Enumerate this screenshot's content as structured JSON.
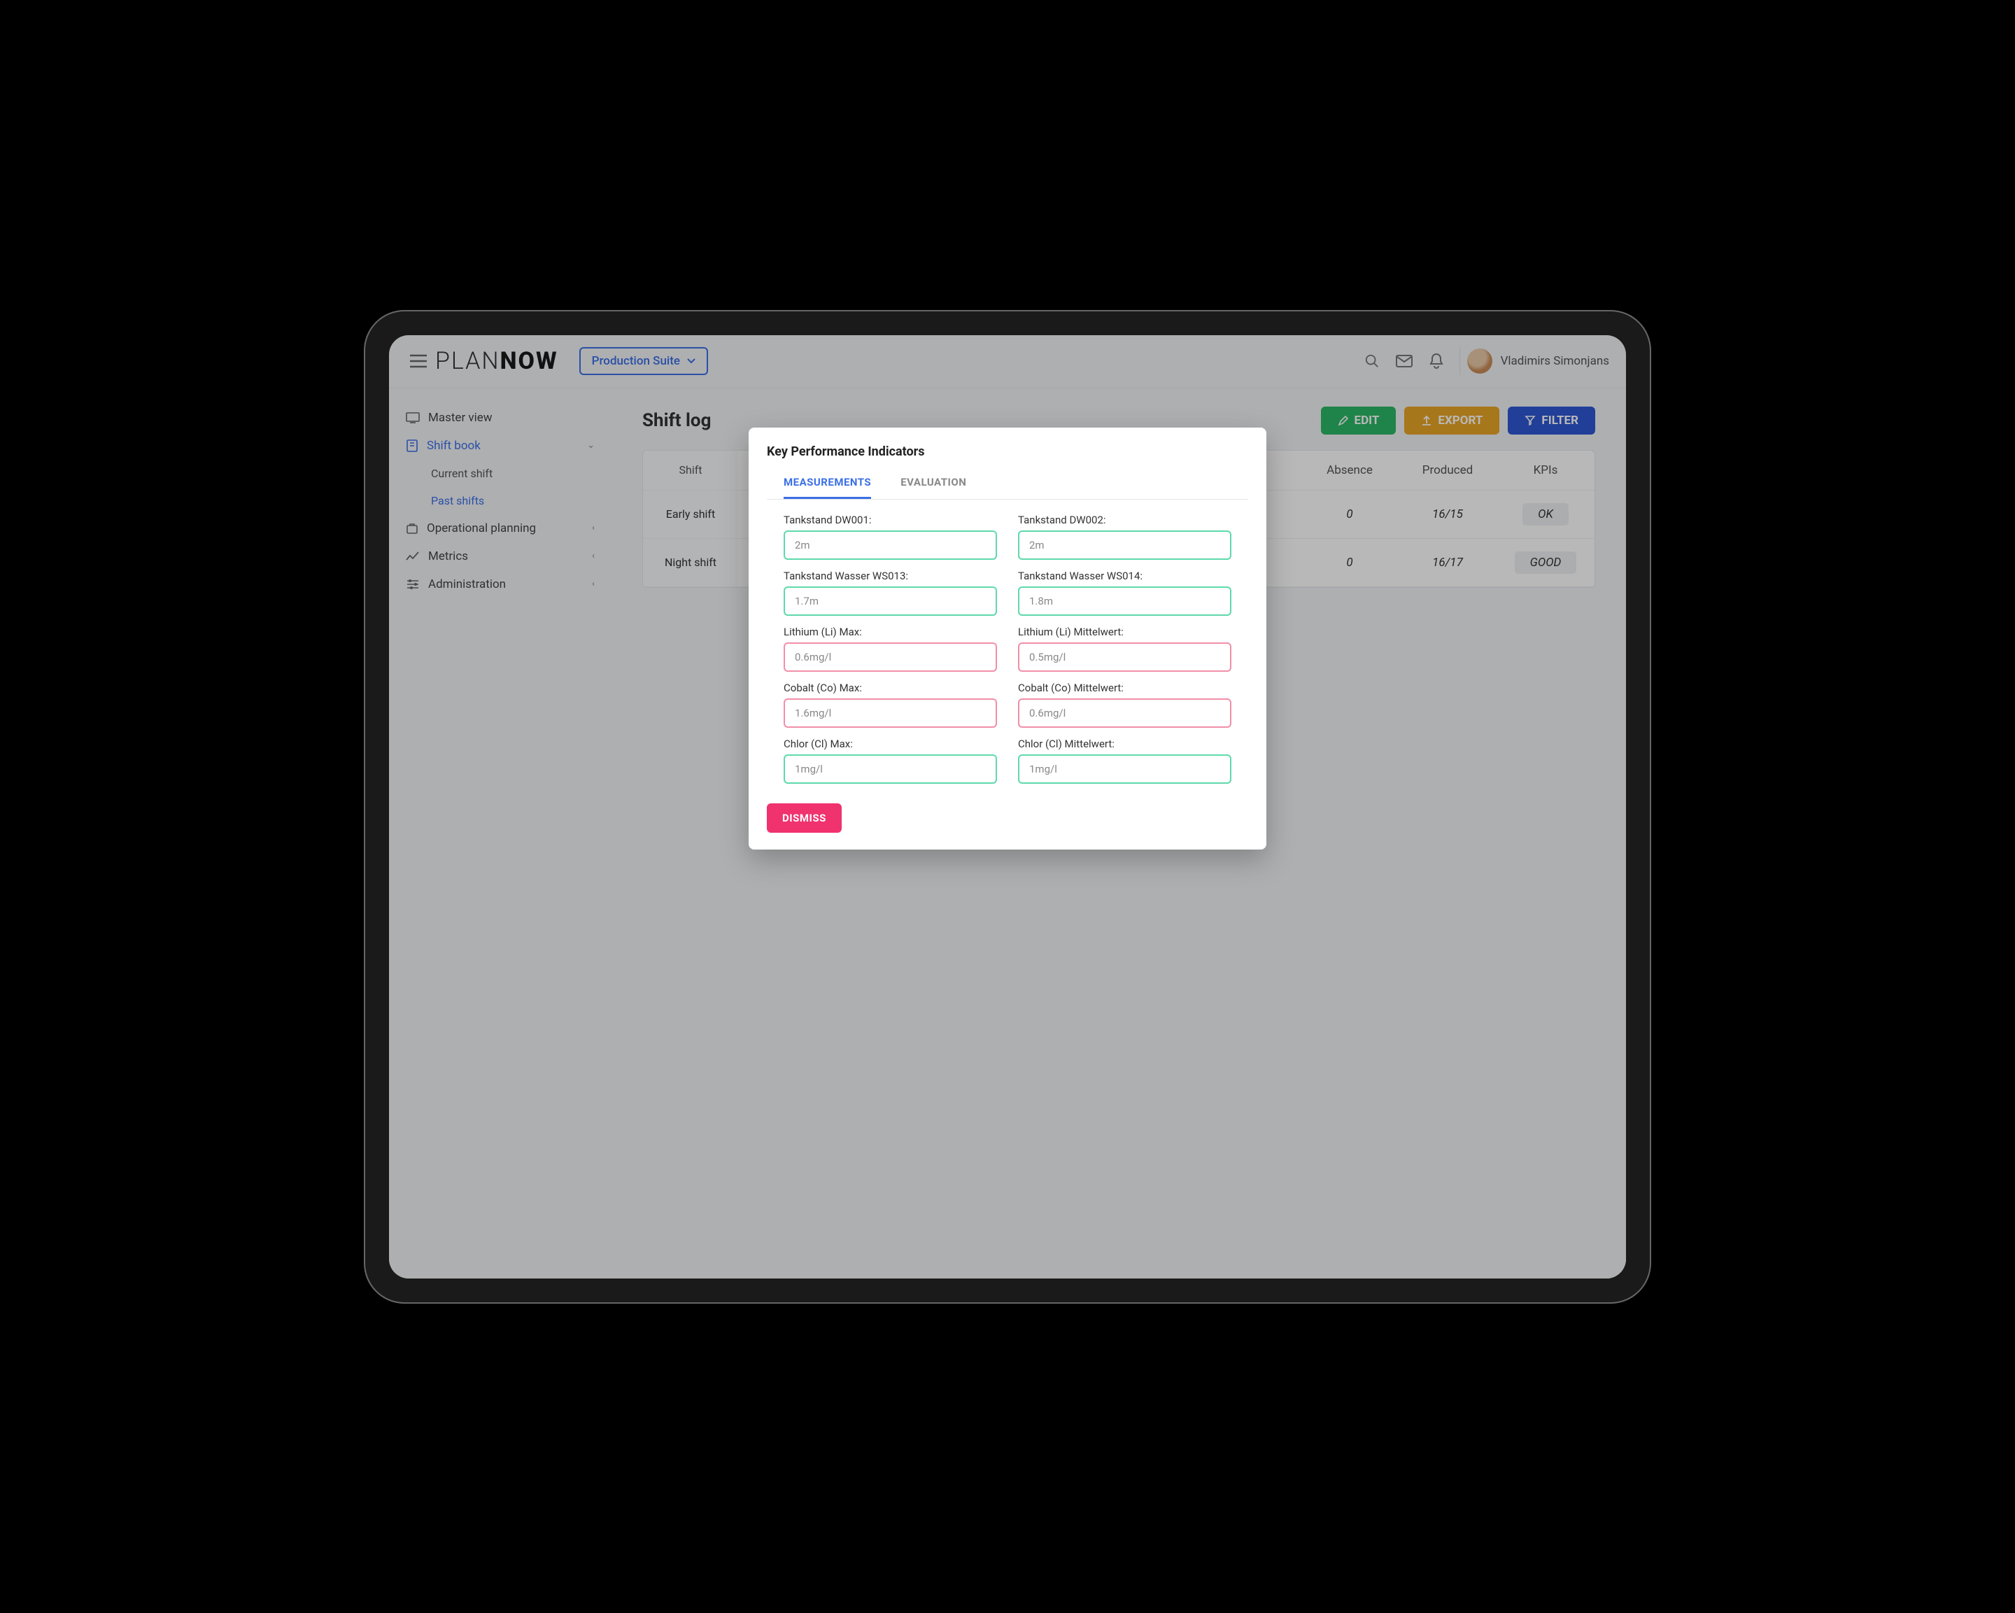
{
  "header": {
    "logo_thin": "PLAN",
    "logo_bold": "NOW",
    "suite": "Production Suite",
    "user": "Vladimirs Simonjans"
  },
  "sidebar": {
    "items": [
      {
        "label": "Master view"
      },
      {
        "label": "Shift book"
      },
      {
        "label": "Operational planning"
      },
      {
        "label": "Metrics"
      },
      {
        "label": "Administration"
      }
    ],
    "shift_subitems": [
      {
        "label": "Current shift"
      },
      {
        "label": "Past shifts"
      }
    ]
  },
  "page": {
    "title": "Shift log",
    "buttons": {
      "edit": "EDIT",
      "export": "EXPORT",
      "filter": "FILTER"
    }
  },
  "table": {
    "headers": [
      "Shift",
      "Absence",
      "Produced",
      "KPIs"
    ],
    "rows": [
      {
        "shift": "Early shift",
        "absence": "0",
        "produced": "16/15",
        "kpi": "OK"
      },
      {
        "shift": "Night shift",
        "absence": "0",
        "produced": "16/17",
        "kpi": "GOOD"
      }
    ]
  },
  "modal": {
    "title": "Key Performance Indicators",
    "tabs": [
      "MEASUREMENTS",
      "EVALUATION"
    ],
    "fields": [
      {
        "label": "Tankstand DW001:",
        "value": "2m",
        "tone": "green"
      },
      {
        "label": "Tankstand DW002:",
        "value": "2m",
        "tone": "green"
      },
      {
        "label": "Tankstand Wasser WS013:",
        "value": "1.7m",
        "tone": "green"
      },
      {
        "label": "Tankstand Wasser WS014:",
        "value": "1.8m",
        "tone": "green"
      },
      {
        "label": "Lithium (Li) Max:",
        "value": "0.6mg/l",
        "tone": "pink"
      },
      {
        "label": "Lithium (Li) Mittelwert:",
        "value": "0.5mg/l",
        "tone": "pink"
      },
      {
        "label": "Cobalt (Co) Max:",
        "value": "1.6mg/l",
        "tone": "pink"
      },
      {
        "label": "Cobalt (Co) Mittelwert:",
        "value": "0.6mg/l",
        "tone": "pink"
      },
      {
        "label": "Chlor (Cl) Max:",
        "value": "1mg/l",
        "tone": "green"
      },
      {
        "label": "Chlor (Cl) Mittelwert:",
        "value": "1mg/l",
        "tone": "green"
      }
    ],
    "dismiss": "DISMISS"
  },
  "colors": {
    "primary": "#3b6fe6",
    "green_ok": "#5fd9ab",
    "pink_warn": "#f18fa8",
    "dismiss": "#f0326f"
  }
}
